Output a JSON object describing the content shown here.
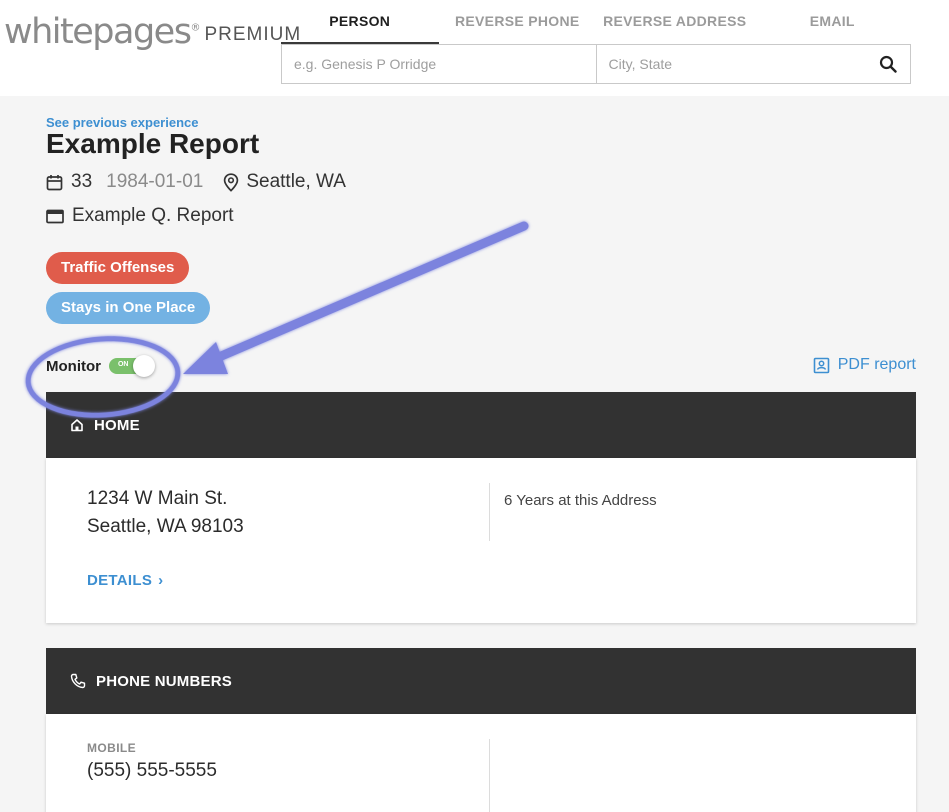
{
  "header": {
    "logo_text": "whitepages",
    "logo_tm": "®",
    "logo_premium": "PREMIUM",
    "tabs": [
      {
        "label": "PERSON",
        "active": true
      },
      {
        "label": "REVERSE PHONE",
        "active": false
      },
      {
        "label": "REVERSE ADDRESS",
        "active": false
      },
      {
        "label": "EMAIL",
        "active": false
      }
    ],
    "search": {
      "name_placeholder": "e.g. Genesis P Orridge",
      "location_placeholder": "City, State",
      "icon": "search-icon"
    }
  },
  "profile": {
    "previous_link": "See previous experience",
    "name": "Example Report",
    "age": "33",
    "dob": "1984-01-01",
    "location": "Seattle, WA",
    "alias": "Example Q. Report",
    "badges": [
      {
        "label": "Traffic Offenses",
        "color": "#e05c4b"
      },
      {
        "label": "Stays in One Place",
        "color": "#73b2e3"
      }
    ],
    "monitor_label": "Monitor",
    "monitor_state": "ON",
    "pdf_label": "PDF report"
  },
  "home": {
    "title": "HOME",
    "address_line1": "1234 W Main St.",
    "address_line2": "Seattle, WA 98103",
    "years": "6 Years at this Address",
    "details_label": "DETAILS",
    "details_chevron": "›"
  },
  "phone": {
    "title": "PHONE NUMBERS",
    "mobile_label": "MOBILE",
    "mobile_number": "(555) 555-5555"
  },
  "colors": {
    "accent_blue": "#3d8fd1",
    "section_header": "#323232",
    "toggle_on": "#7ac06b",
    "annotation": "#7b83de"
  }
}
